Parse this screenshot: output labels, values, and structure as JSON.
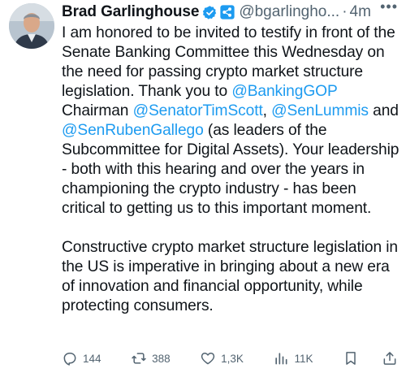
{
  "author": {
    "name": "Brad Garlinghouse",
    "handle": "@bgarlingho...",
    "separator": "·",
    "time": "4m"
  },
  "tweet": {
    "paragraph1": [
      {
        "type": "text",
        "text": "I am honored to be invited to testify in front of the Senate Banking Committee this Wednesday on the need for passing crypto market structure legislation. Thank you to "
      },
      {
        "type": "mention",
        "text": "@BankingGOP"
      },
      {
        "type": "text",
        "text": " Chairman "
      },
      {
        "type": "mention",
        "text": "@SenatorTimScott"
      },
      {
        "type": "text",
        "text": ", "
      },
      {
        "type": "mention",
        "text": "@SenLummis"
      },
      {
        "type": "text",
        "text": " and "
      },
      {
        "type": "mention",
        "text": "@SenRubenGallego"
      },
      {
        "type": "text",
        "text": " (as leaders of the Subcommittee for Digital Assets). Your leadership - both with this hearing and over the years in championing the crypto industry - has been critical to getting us to this important moment."
      }
    ],
    "paragraph2": "Constructive crypto market structure legislation in the US is imperative in bringing about a new era of innovation and financial opportunity, while protecting consumers."
  },
  "actions": {
    "replies": "144",
    "reposts": "388",
    "likes": "1,3K",
    "views": "11K"
  },
  "colors": {
    "accent": "#1d9bf0",
    "muted": "#536471",
    "text": "#0f1419"
  }
}
